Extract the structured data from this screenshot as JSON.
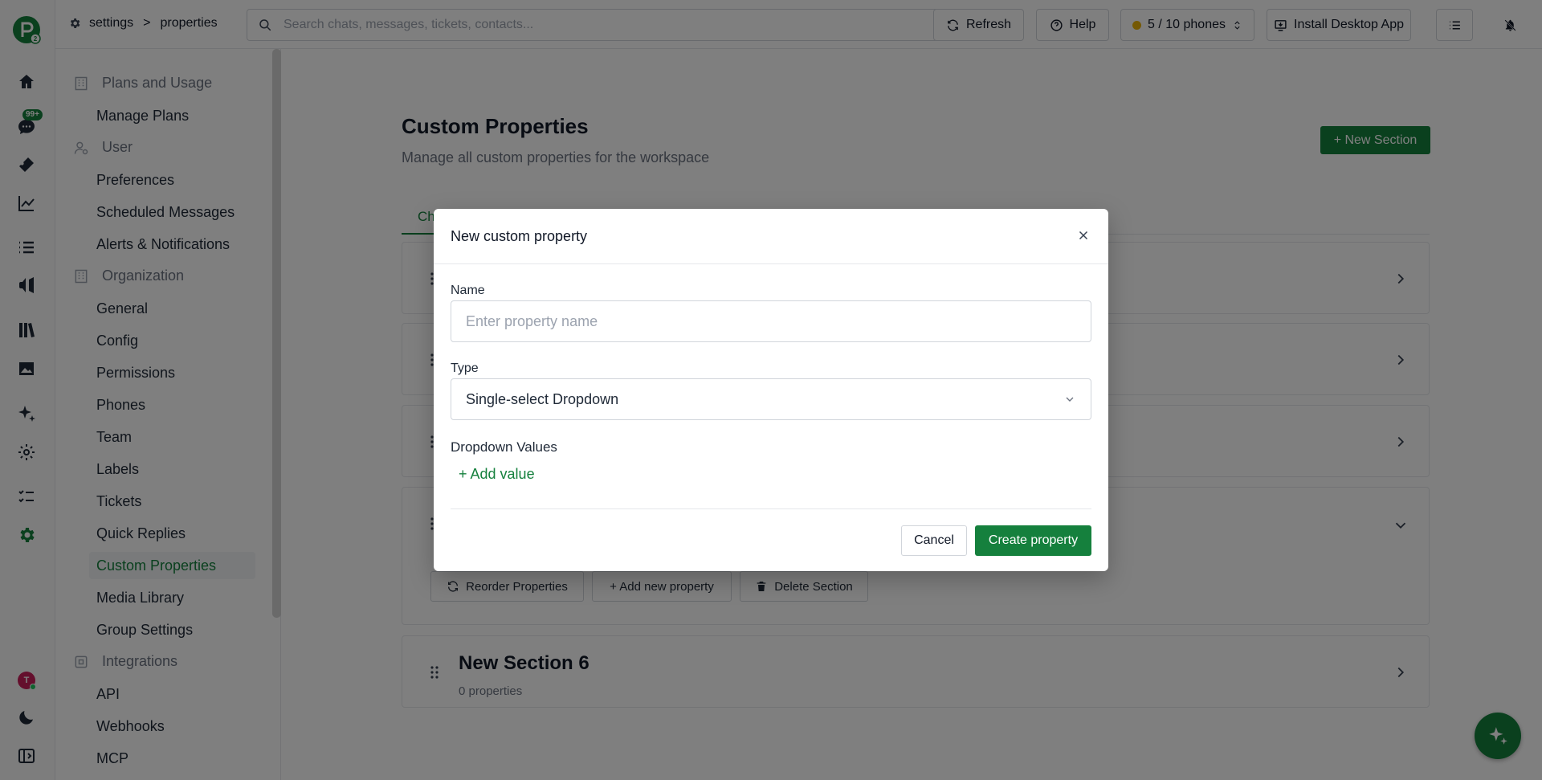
{
  "breadcrumb": {
    "root": "settings",
    "separator": ">",
    "current": "properties"
  },
  "search": {
    "placeholder": "Search chats, messages, tickets, contacts..."
  },
  "topbar": {
    "refresh": "Refresh",
    "help": "Help",
    "phones": "5 / 10 phones",
    "install": "Install Desktop App"
  },
  "rail": {
    "unread_badge": "99+",
    "avatar_initial": "T"
  },
  "sidebar": {
    "group_plans": "Plans and Usage",
    "manage_plans": "Manage Plans",
    "group_user": "User",
    "preferences": "Preferences",
    "scheduled_messages": "Scheduled Messages",
    "alerts": "Alerts & Notifications",
    "group_org": "Organization",
    "general": "General",
    "config": "Config",
    "permissions": "Permissions",
    "phones": "Phones",
    "team": "Team",
    "labels": "Labels",
    "tickets": "Tickets",
    "quick_replies": "Quick Replies",
    "custom_properties": "Custom Properties",
    "media_library": "Media Library",
    "group_settings": "Group Settings",
    "group_integrations": "Integrations",
    "api": "API",
    "webhooks": "Webhooks",
    "mcp": "MCP"
  },
  "page": {
    "title": "Custom Properties",
    "subtitle": "Manage all custom properties for the workspace",
    "new_section": "+ New Section",
    "tab_visible": "Ch"
  },
  "section_actions": {
    "reorder": "Reorder Properties",
    "add_property": "+ Add new property",
    "delete_section": "Delete Section"
  },
  "last_section": {
    "name": "New Section 6",
    "count": "0 properties"
  },
  "modal": {
    "title": "New custom property",
    "name_label": "Name",
    "name_placeholder": "Enter property name",
    "type_label": "Type",
    "type_value": "Single-select Dropdown",
    "dropdown_label": "Dropdown Values",
    "add_value": "+ Add value",
    "cancel": "Cancel",
    "create": "Create property"
  },
  "colors": {
    "brand": "#15803d",
    "overlay": "rgba(0,0,0,0.5)"
  }
}
